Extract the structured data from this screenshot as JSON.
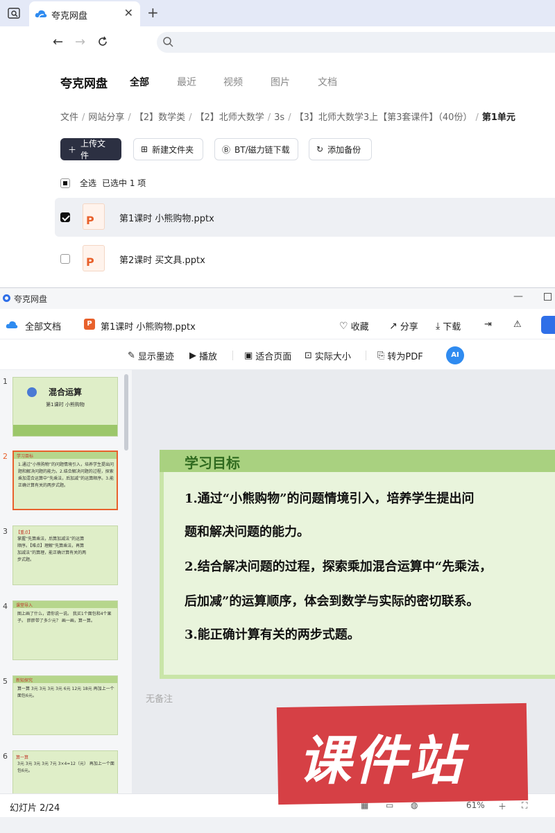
{
  "browser": {
    "tab_title": "夸克网盘",
    "close_glyph": "✕",
    "newtab_glyph": "+"
  },
  "drive": {
    "title": "夸克网盘",
    "tabs": [
      "全部",
      "最近",
      "视频",
      "图片",
      "文档"
    ],
    "breadcrumb": [
      "文件",
      "网站分享",
      "【2】数学类",
      "【2】北师大数学",
      "3s",
      "【3】北师大数学3上【第3套课件】（40份）",
      "第1单元"
    ],
    "buttons": {
      "upload": "上传文件",
      "new_folder": "新建文件夹",
      "bt": "BT/磁力链下载",
      "backup": "添加备份"
    },
    "select_all": "全选",
    "selected": "已选中 1 项",
    "files": [
      {
        "name": "第1课时  小熊购物.pptx",
        "selected": true
      },
      {
        "name": "第2课时  买文具.pptx",
        "selected": false
      }
    ]
  },
  "viewer": {
    "window_title": "夸克网盘",
    "all_docs": "全部文档",
    "file_name": "第1课时 小熊购物.pptx",
    "file_badge": "P",
    "actions": {
      "favorite": "收藏",
      "share": "分享",
      "download": "下载"
    },
    "toolbar": {
      "ink": "显示墨迹",
      "play": "播放",
      "fit": "适合页面",
      "actual": "实际大小",
      "pdf": "转为PDF",
      "ai": "AI"
    },
    "thumbnails": [
      {
        "num": "1",
        "big": "混合运算",
        "small": "第1课时   小熊购物"
      },
      {
        "num": "2",
        "tag": "学习目标",
        "text": "1.通过“小熊购物”的问题情境引入，培养学生提出问题和解决问题的能力。2.结合解决问题的过程，探索乘加混合运算中“先乘法，后加减”的运算顺序。3.能正确计算有关的两步式题。"
      },
      {
        "num": "3",
        "tag": "【重点】",
        "text": "掌握“先算乘法，后算加减法”的运算顺序。【难点】理解“先算乘法，再算加减法”的算理，能正确计算有关的两步式题。"
      },
      {
        "num": "4",
        "tag": "课堂导入",
        "text": "图上画了什么，请你说一说。  我买1个面包和4个果子。  胖胖带了多少元？ 画一画，算一算。"
      },
      {
        "num": "5",
        "tag": "新知探究",
        "text": "算一算  3元 3元 3元 3元  6元  12元  18元  再加上一个面包6元。"
      },
      {
        "num": "6",
        "tag": "算一算",
        "text": "3元 3元 3元 3元  7元  3×4=12（元）  再加上一个面包6元。"
      }
    ],
    "slide": {
      "heading": "学习目标",
      "lines": [
        "1.通过“小熊购物”的问题情境引入，培养学生提出问",
        "题和解决问题的能力。",
        "2.结合解决问题的过程，探索乘加混合运算中“先乘法，",
        "后加减”的运算顺序，体会到数学与实际的密切联系。",
        "3.能正确计算有关的两步式题。"
      ]
    },
    "notes": "无备注",
    "watermark": "课件站",
    "status": {
      "slide": "幻灯片 2/24",
      "zoom": "61%"
    }
  },
  "colors": {
    "accent": "#2f6fe8",
    "ppt": "#e8612c",
    "slide_green": "#c9e5a8",
    "dark_button": "#2c3042"
  }
}
